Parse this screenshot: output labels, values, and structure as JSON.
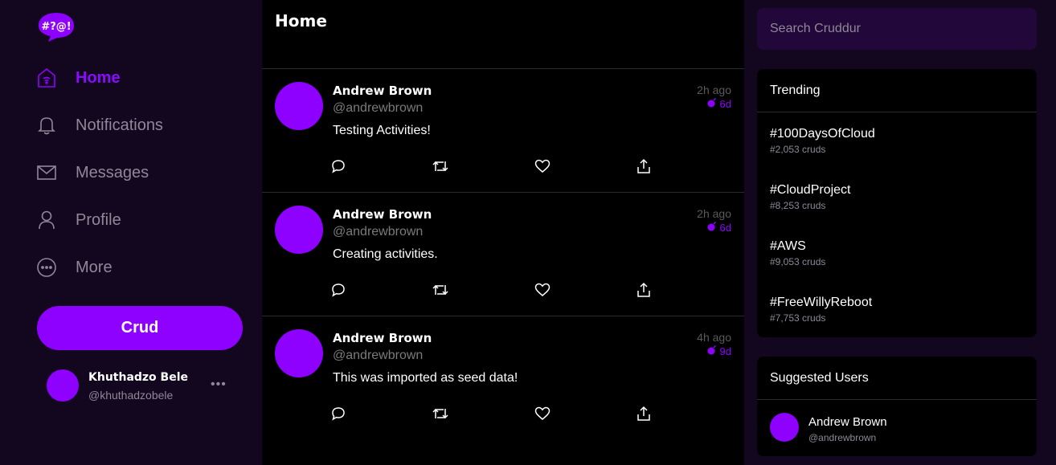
{
  "app": {
    "logo_text": "#?@!",
    "accent_color": "#8e00ff"
  },
  "nav": {
    "items": [
      {
        "label": "Home",
        "icon": "home-icon",
        "active": true
      },
      {
        "label": "Notifications",
        "icon": "bell-icon",
        "active": false
      },
      {
        "label": "Messages",
        "icon": "envelope-icon",
        "active": false
      },
      {
        "label": "Profile",
        "icon": "user-icon",
        "active": false
      },
      {
        "label": "More",
        "icon": "more-circle-icon",
        "active": false
      }
    ],
    "crud_label": "Crud"
  },
  "current_user": {
    "name": "Khuthadzo Bele",
    "handle": "@khuthadzobele",
    "more": "•••"
  },
  "main": {
    "title": "Home",
    "activities": [
      {
        "name": "Andrew Brown",
        "handle": "@andrewbrown",
        "message": "Testing Activities!",
        "time": "2h ago",
        "expires": "6d"
      },
      {
        "name": "Andrew Brown",
        "handle": "@andrewbrown",
        "message": "Creating activities.",
        "time": "2h ago",
        "expires": "6d"
      },
      {
        "name": "Andrew Brown",
        "handle": "@andrewbrown",
        "message": "This was imported as seed data!",
        "time": "4h ago",
        "expires": "9d"
      }
    ],
    "action_icons": [
      "reply-icon",
      "repost-icon",
      "like-icon",
      "share-icon"
    ]
  },
  "right": {
    "search_placeholder": "Search Cruddur",
    "trending": {
      "title": "Trending",
      "items": [
        {
          "tag": "#100DaysOfCloud",
          "count": "#2,053 cruds"
        },
        {
          "tag": "#CloudProject",
          "count": "#8,253 cruds"
        },
        {
          "tag": "#AWS",
          "count": "#9,053 cruds"
        },
        {
          "tag": "#FreeWillyReboot",
          "count": "#7,753 cruds"
        }
      ]
    },
    "suggested": {
      "title": "Suggested Users",
      "users": [
        {
          "name": "Andrew Brown",
          "handle": "@andrewbrown"
        }
      ]
    }
  }
}
